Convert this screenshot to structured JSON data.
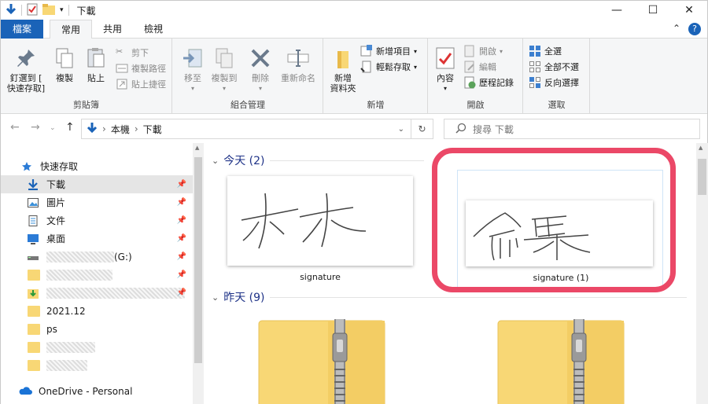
{
  "window": {
    "title": "下載",
    "controls": [
      "minimize",
      "maximize",
      "close"
    ]
  },
  "ribbon_tabs": [
    {
      "label": "檔案"
    },
    {
      "label": "常用"
    },
    {
      "label": "共用"
    },
    {
      "label": "檢視"
    }
  ],
  "ribbon": {
    "clipboard": {
      "label": "剪貼簿",
      "pin": "釘選到 [\n快速存取]",
      "copy": "複製",
      "paste": "貼上",
      "cut": "剪下",
      "copy_path": "複製路徑",
      "paste_shortcut": "貼上捷徑"
    },
    "organize": {
      "label": "組合管理",
      "move_to": "移至",
      "copy_to": "複製到",
      "delete": "刪除",
      "rename": "重新命名"
    },
    "new": {
      "label": "新增",
      "new_folder": "新增\n資料夾",
      "new_item": "新增項目",
      "easy_access": "輕鬆存取"
    },
    "open": {
      "label": "開啟",
      "properties": "內容",
      "open": "開啟",
      "edit": "編輯",
      "history": "歷程記錄"
    },
    "select": {
      "label": "選取",
      "select_all": "全選",
      "select_none": "全部不選",
      "invert": "反向選擇"
    }
  },
  "address": {
    "crumbs": [
      "本機",
      "下載"
    ],
    "search_placeholder": "搜尋 下載"
  },
  "nav": {
    "quick_access": "快速存取",
    "items": [
      {
        "label": "下載",
        "icon": "download-icon",
        "pinned": true,
        "selected": true
      },
      {
        "label": "圖片",
        "icon": "pictures-icon",
        "pinned": true
      },
      {
        "label": "文件",
        "icon": "documents-icon",
        "pinned": true
      },
      {
        "label": "桌面",
        "icon": "desktop-icon",
        "pinned": true
      },
      {
        "label": "(G:)",
        "icon": "drive-icon",
        "pinned": true,
        "blurred": true
      },
      {
        "label": "",
        "icon": "folder-icon",
        "pinned": true,
        "blurred": true
      },
      {
        "label": "",
        "icon": "folder-download-icon",
        "pinned": true,
        "blurred": true
      },
      {
        "label": "2021.12",
        "icon": "folder-icon"
      },
      {
        "label": "ps",
        "icon": "folder-icon"
      },
      {
        "label": "",
        "icon": "folder-icon",
        "blurred": true
      },
      {
        "label": "",
        "icon": "folder-icon",
        "blurred": true
      }
    ],
    "onedrive": "OneDrive - Personal"
  },
  "content": {
    "today": {
      "label": "今天 (2)"
    },
    "yesterday": {
      "label": "昨天 (9)"
    },
    "files": [
      {
        "name": "signature"
      },
      {
        "name": "signature (1)"
      }
    ]
  },
  "colors": {
    "accent": "#1a63b8",
    "highlight": "#eb4867",
    "folder": "#f8d775"
  }
}
